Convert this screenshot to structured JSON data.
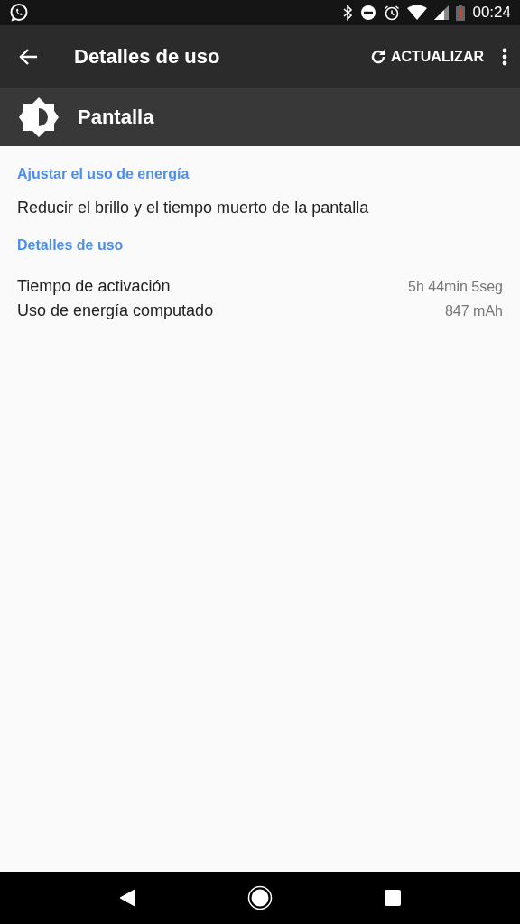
{
  "status_bar": {
    "time": "00:24"
  },
  "toolbar": {
    "title": "Detalles de uso",
    "action": "ACTUALIZAR"
  },
  "header": {
    "title": "Pantalla"
  },
  "sections": [
    {
      "title": "Ajustar el uso de energía",
      "items": [
        {
          "kind": "action",
          "label": "Reducir el brillo y el tiempo muerto de la pantalla"
        }
      ]
    },
    {
      "title": "Detalles de uso",
      "items": [
        {
          "kind": "detail",
          "label": "Tiempo de activación",
          "value": "5h 44min 5seg"
        },
        {
          "kind": "detail",
          "label": "Uso de energía computado",
          "value": "847 mAh"
        }
      ]
    }
  ]
}
